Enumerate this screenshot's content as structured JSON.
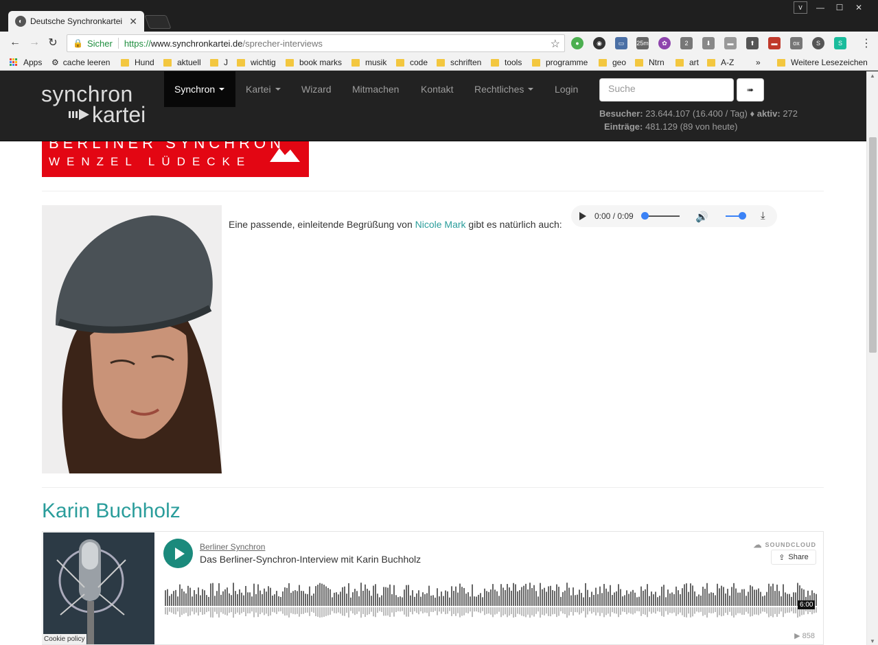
{
  "window": {
    "tab_title": "Deutsche Synchronkartei",
    "profile_label": "v"
  },
  "toolbar": {
    "secure_label": "Sicher",
    "url_proto": "https://",
    "url_host": "www.synchronkartei.de",
    "url_path": "/sprecher-interviews"
  },
  "bookmarks": {
    "items": [
      "Apps",
      "cache leeren",
      "Hund",
      "aktuell",
      "J",
      "wichtig",
      "book marks",
      "musik",
      "code",
      "schriften",
      "tools",
      "programme",
      "geo",
      "Ntrn",
      "art",
      "A-Z"
    ],
    "more": "»",
    "other": "Weitere Lesezeichen"
  },
  "site": {
    "logo_line1": "synchron",
    "logo_line2": "kartei",
    "nav": [
      "Synchron",
      "Kartei",
      "Wizard",
      "Mitmachen",
      "Kontakt",
      "Rechtliches",
      "Login"
    ],
    "search_placeholder": "Suche",
    "search_button": "➠",
    "stats": {
      "besucher_label": "Besucher:",
      "besucher_value": "23.644.107 (16.400 / Tag) ♦",
      "aktiv_label": "aktiv:",
      "aktiv_value": "272",
      "eintraege_label": "Einträge:",
      "eintraege_value": "481.129 (89 von heute)"
    }
  },
  "banner": {
    "line1": "BERLINER SYNCHRON",
    "line2": "WENZEL LÜDECKE"
  },
  "intro": {
    "text_before": "Eine passende, einleitende Begrüßung von ",
    "link": "Nicole Mark",
    "text_after": " gibt es natürlich auch:"
  },
  "audio": {
    "time": "0:00 / 0:09",
    "progress": 0.0,
    "volume": 1.0
  },
  "section": {
    "heading": "Karin Buchholz"
  },
  "soundcloud": {
    "user": "Berliner Synchron",
    "title": "Das Berliner-Synchron-Interview mit Karin Buchholz",
    "brand": "SOUNDCLOUD",
    "share": "Share",
    "duration": "6:00",
    "plays": "858"
  },
  "cookie": "Cookie policy",
  "colors": {
    "accent": "#2a9d9b",
    "banner_red": "#e30613",
    "sc_play": "#1b8a7c"
  }
}
